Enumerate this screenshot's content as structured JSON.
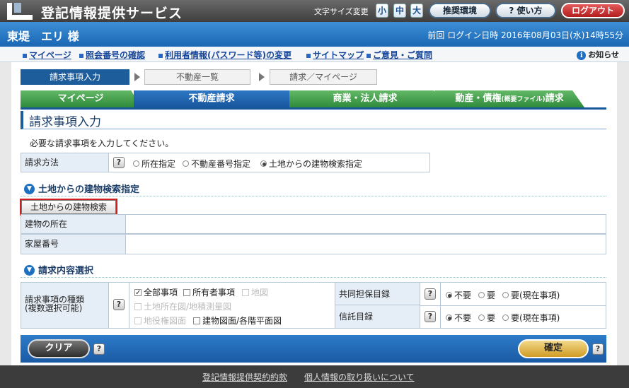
{
  "header": {
    "app_title": "登記情報提供サービス",
    "font_size_label": "文字サイズ変更",
    "font_sizes": [
      "小",
      "中",
      "大"
    ],
    "env_button": "推奨環境",
    "help_button": "? 使い方",
    "logout_button": "ログアウト"
  },
  "user": {
    "name": "東堤　エリ 様",
    "last_login": "前回 ログイン日時 2016年08月03日(水)14時55分"
  },
  "links": {
    "mypage": "マイページ",
    "reference_check": "照会番号の確認",
    "user_info": "利用者情報(パスワード等)の変更",
    "sitemap": "サイトマップ",
    "feedback": "ご意見・ご質問",
    "notice": "お知らせ"
  },
  "steps": [
    "請求事項入力",
    "不動産一覧",
    "請求／マイページ"
  ],
  "tabs": {
    "mypage": "マイページ",
    "realestate": "不動産請求",
    "commercial": "商業・法人請求",
    "movable_main": "動産・債権",
    "movable_small": "(概要ファイル)",
    "movable_suffix": "請求"
  },
  "page_title": "請求事項入力",
  "instruction": "必要な請求事項を入力してください。",
  "request_method": {
    "label": "請求方法",
    "help": "?",
    "options": [
      "所在指定",
      "不動産番号指定",
      "土地からの建物検索指定"
    ]
  },
  "section_land": {
    "title": "土地からの建物検索指定",
    "search_button": "土地からの建物検索",
    "location_label": "建物の所在",
    "house_number_label": "家屋番号"
  },
  "section_content": {
    "title": "請求内容選択",
    "type_label_1": "請求事項の種類",
    "type_label_2": "(複数選択可能)",
    "help": "?",
    "checks": [
      "全部事項",
      "所有者事項",
      "地図",
      "土地所在図/地積測量図",
      "地役権図面",
      "建物図面/各階平面図"
    ],
    "joint_label": "共同担保目録",
    "trust_label": "信託目録",
    "joint_options": [
      "不要",
      "要",
      "要(現在事項)"
    ],
    "trust_options": [
      "不要",
      "要",
      "要(現在事項)"
    ]
  },
  "bottom": {
    "clear": "クリア",
    "confirm": "確定",
    "help": "?"
  },
  "footer": {
    "terms": "登記情報提供契約約款",
    "privacy": "個人情報の取り扱いについて"
  }
}
